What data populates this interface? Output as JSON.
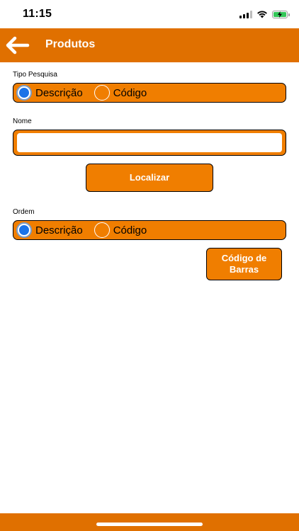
{
  "status_bar": {
    "time": "11:15",
    "battery_color": "#34c759"
  },
  "header": {
    "title": "Produtos",
    "background_color": "#e07000",
    "back_icon": "arrow-left-icon"
  },
  "search_type": {
    "label": "Tipo Pesquisa",
    "options": [
      "Descrição",
      "Código"
    ],
    "selected": "Descrição"
  },
  "name": {
    "label": "Nome",
    "value": "",
    "placeholder": ""
  },
  "search_button": {
    "label": "Localizar"
  },
  "order": {
    "label": "Ordem",
    "options": [
      "Descrição",
      "Código"
    ],
    "selected": "Descrição"
  },
  "barcode_button": {
    "label": "Código de\nBarras"
  },
  "colors": {
    "accent": "#f07e00",
    "header": "#e07000",
    "radio_selected": "#1a73e8"
  }
}
